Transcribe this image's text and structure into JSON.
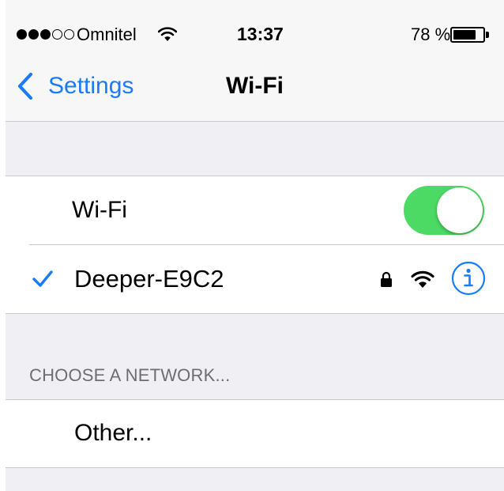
{
  "status_bar": {
    "signal_filled": 3,
    "signal_total": 5,
    "carrier": "Omnitel",
    "time": "13:37",
    "battery_percent_text": "78 %",
    "battery_level": 0.78
  },
  "nav": {
    "back_label": "Settings",
    "title": "Wi-Fi"
  },
  "wifi_toggle": {
    "label": "Wi-Fi",
    "on": true
  },
  "connected_network": {
    "name": "Deeper-E9C2",
    "secured": true,
    "icons": [
      "checkmark-icon",
      "lock-icon",
      "wifi-signal-icon",
      "info-icon"
    ]
  },
  "choose_network": {
    "header": "CHOOSE A NETWORK...",
    "other_label": "Other..."
  },
  "colors": {
    "accent": "#1a7cf5",
    "toggle_on": "#4cd964",
    "grouped_background": "#efeff4",
    "separator": "#c8c7cc",
    "section_header_text": "#6d6d72"
  }
}
